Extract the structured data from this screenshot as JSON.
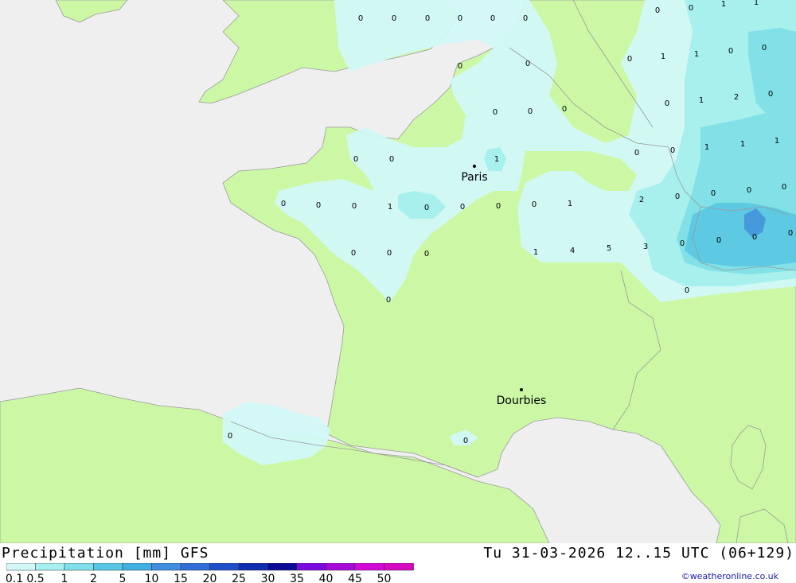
{
  "map": {
    "colors": {
      "sea": "#efefef",
      "land": "#ccf8a6",
      "precip_0_1": "#d2f8f8",
      "precip_0_5": "#a6f0f2",
      "precip_1": "#7de0ea",
      "precip_2": "#58c7e6",
      "precip_5": "#3f96de",
      "border": "#9a9a9a"
    },
    "cities": [
      {
        "name": "Paris"
      },
      {
        "name": "Dourbies"
      }
    ],
    "values": [
      "0",
      "0",
      "0",
      "0",
      "0",
      "0",
      "0",
      "0",
      "1",
      "1",
      "0",
      "0",
      "0",
      "1",
      "1",
      "0",
      "0",
      "0",
      "1",
      "2",
      "0",
      "0",
      "0",
      "0",
      "1",
      "0",
      "0",
      "1",
      "1",
      "1",
      "0",
      "0",
      "0",
      "0",
      "0",
      "1",
      "0",
      "0",
      "0",
      "0",
      "1",
      "2",
      "0",
      "0",
      "0",
      "0",
      "0",
      "0",
      "0",
      "1",
      "4",
      "5",
      "3",
      "0",
      "0",
      "0",
      "0",
      "0",
      "0",
      "0"
    ]
  },
  "footer": {
    "title": "Precipitation [mm] GFS",
    "valid_time": "Tu 31-03-2026 12..15 UTC (06+129)",
    "credit": "©weatheronline.co.uk"
  },
  "legend": {
    "ticks": [
      "0.1",
      "0.5",
      "1",
      "2",
      "5",
      "10",
      "15",
      "20",
      "25",
      "30",
      "35",
      "40",
      "45",
      "50"
    ],
    "colors": [
      "#d2f8f8",
      "#a6f0f2",
      "#7de0ea",
      "#58c7e6",
      "#3fb0e2",
      "#3f8ee0",
      "#2f6ed8",
      "#1f4ec8",
      "#0f2eb0",
      "#0a0a96",
      "#7a0ae0",
      "#a60ad8",
      "#d20ad8",
      "#d60ac0"
    ],
    "arrow_color": "#b81ab8"
  }
}
